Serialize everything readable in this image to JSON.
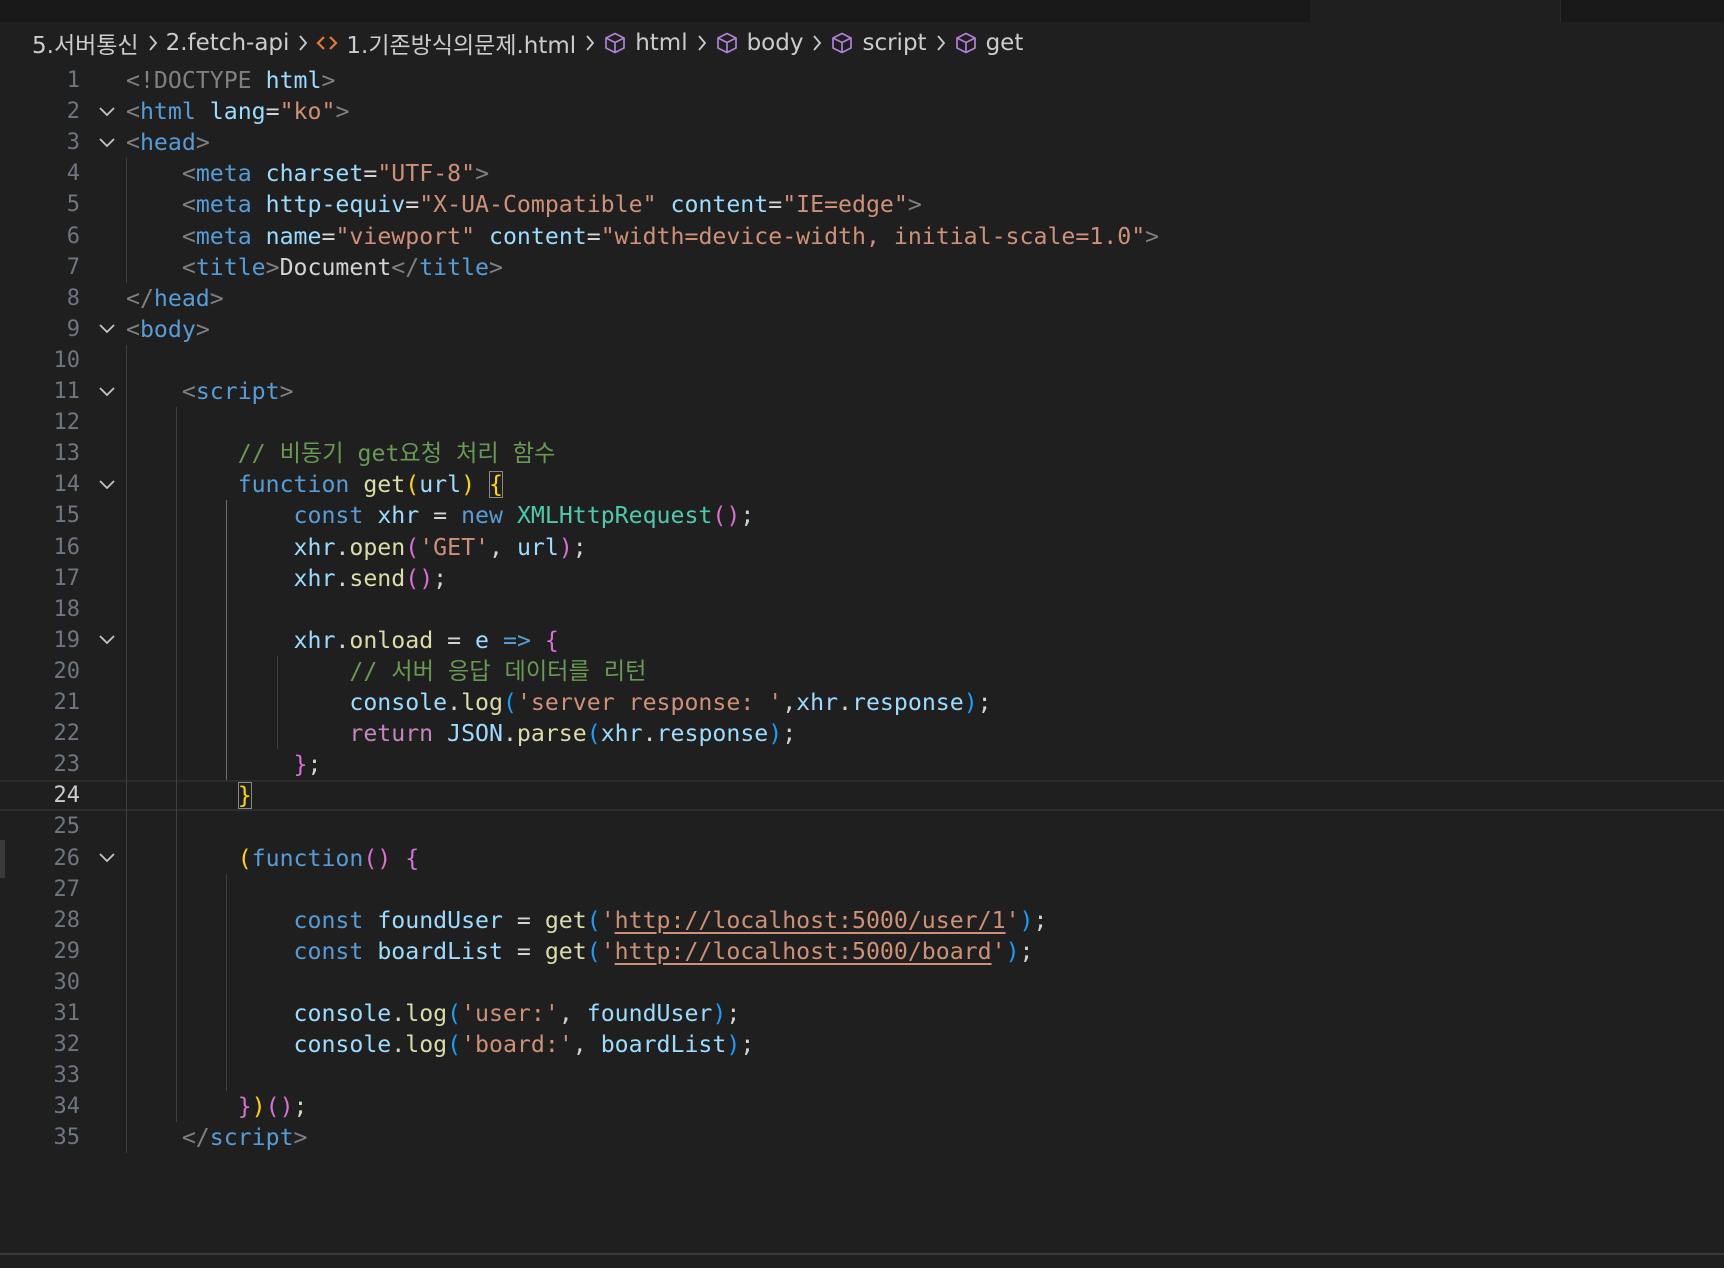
{
  "breadcrumb": {
    "items": [
      {
        "label": "5.서버통신",
        "icon": ""
      },
      {
        "label": "2.fetch-api",
        "icon": ""
      },
      {
        "label": "1.기존방식의문제.html",
        "icon": "html-file-icon"
      },
      {
        "label": "html",
        "icon": "cube-symbol-icon"
      },
      {
        "label": "body",
        "icon": "cube-symbol-icon"
      },
      {
        "label": "script",
        "icon": "cube-symbol-icon"
      },
      {
        "label": "get",
        "icon": "cube-symbol-icon"
      }
    ]
  },
  "editor": {
    "current_line": 24,
    "colors": {
      "tag_bracket": "#808080",
      "tag": "#569cd6",
      "attr": "#9cdcfe",
      "string": "#ce9178",
      "comment": "#6a9955",
      "keyword": "#569cd6",
      "control": "#c586c0",
      "function": "#dcdcaa",
      "variable": "#9cdcfe",
      "class": "#4ec9b0",
      "bracket1": "#ffd700",
      "bracket2": "#da70d6",
      "bracket3": "#179fff"
    },
    "lines": [
      {
        "n": 1,
        "fold": false,
        "tokens": [
          [
            "<!DOCTYPE ",
            "tb"
          ],
          [
            "html",
            "at"
          ],
          [
            ">",
            "tb"
          ]
        ]
      },
      {
        "n": 2,
        "fold": true,
        "tokens": [
          [
            "<",
            "tb"
          ],
          [
            "html",
            "tg"
          ],
          [
            " ",
            "pl"
          ],
          [
            "lang",
            "at"
          ],
          [
            "=",
            "pl"
          ],
          [
            "\"ko\"",
            "st"
          ],
          [
            ">",
            "tb"
          ]
        ]
      },
      {
        "n": 3,
        "fold": true,
        "tokens": [
          [
            "<",
            "tb"
          ],
          [
            "head",
            "tg"
          ],
          [
            ">",
            "tb"
          ]
        ]
      },
      {
        "n": 4,
        "fold": false,
        "tokens": [
          [
            "    ",
            "pl"
          ],
          [
            "<",
            "tb"
          ],
          [
            "meta",
            "tg"
          ],
          [
            " ",
            "pl"
          ],
          [
            "charset",
            "at"
          ],
          [
            "=",
            "pl"
          ],
          [
            "\"UTF-8\"",
            "st"
          ],
          [
            ">",
            "tb"
          ]
        ]
      },
      {
        "n": 5,
        "fold": false,
        "tokens": [
          [
            "    ",
            "pl"
          ],
          [
            "<",
            "tb"
          ],
          [
            "meta",
            "tg"
          ],
          [
            " ",
            "pl"
          ],
          [
            "http-equiv",
            "at"
          ],
          [
            "=",
            "pl"
          ],
          [
            "\"X-UA-Compatible\"",
            "st"
          ],
          [
            " ",
            "pl"
          ],
          [
            "content",
            "at"
          ],
          [
            "=",
            "pl"
          ],
          [
            "\"IE=edge\"",
            "st"
          ],
          [
            ">",
            "tb"
          ]
        ]
      },
      {
        "n": 6,
        "fold": false,
        "tokens": [
          [
            "    ",
            "pl"
          ],
          [
            "<",
            "tb"
          ],
          [
            "meta",
            "tg"
          ],
          [
            " ",
            "pl"
          ],
          [
            "name",
            "at"
          ],
          [
            "=",
            "pl"
          ],
          [
            "\"viewport\"",
            "st"
          ],
          [
            " ",
            "pl"
          ],
          [
            "content",
            "at"
          ],
          [
            "=",
            "pl"
          ],
          [
            "\"width=device-width, initial-scale=1.0\"",
            "st"
          ],
          [
            ">",
            "tb"
          ]
        ]
      },
      {
        "n": 7,
        "fold": false,
        "tokens": [
          [
            "    ",
            "pl"
          ],
          [
            "<",
            "tb"
          ],
          [
            "title",
            "tg"
          ],
          [
            ">",
            "tb"
          ],
          [
            "Document",
            "pl"
          ],
          [
            "</",
            "tb"
          ],
          [
            "title",
            "tg"
          ],
          [
            ">",
            "tb"
          ]
        ]
      },
      {
        "n": 8,
        "fold": false,
        "tokens": [
          [
            "</",
            "tb"
          ],
          [
            "head",
            "tg"
          ],
          [
            ">",
            "tb"
          ]
        ]
      },
      {
        "n": 9,
        "fold": true,
        "tokens": [
          [
            "<",
            "tb"
          ],
          [
            "body",
            "tg"
          ],
          [
            ">",
            "tb"
          ]
        ]
      },
      {
        "n": 10,
        "fold": false,
        "tokens": []
      },
      {
        "n": 11,
        "fold": true,
        "tokens": [
          [
            "    ",
            "pl"
          ],
          [
            "<",
            "tb"
          ],
          [
            "script",
            "tg"
          ],
          [
            ">",
            "tb"
          ]
        ]
      },
      {
        "n": 12,
        "fold": false,
        "tokens": []
      },
      {
        "n": 13,
        "fold": false,
        "tokens": [
          [
            "        ",
            "pl"
          ],
          [
            "// 비동기 get요청 처리 함수",
            "cm"
          ]
        ]
      },
      {
        "n": 14,
        "fold": true,
        "tokens": [
          [
            "        ",
            "pl"
          ],
          [
            "function",
            "kw"
          ],
          [
            " ",
            "pl"
          ],
          [
            "get",
            "fn"
          ],
          [
            "(",
            "b1"
          ],
          [
            "url",
            "vr"
          ],
          [
            ")",
            "b1"
          ],
          [
            " ",
            "pl"
          ],
          [
            "{",
            "b1box"
          ]
        ]
      },
      {
        "n": 15,
        "fold": false,
        "tokens": [
          [
            "            ",
            "pl"
          ],
          [
            "const",
            "kw"
          ],
          [
            " ",
            "pl"
          ],
          [
            "xhr",
            "vr"
          ],
          [
            " = ",
            "pl"
          ],
          [
            "new",
            "kw"
          ],
          [
            " ",
            "pl"
          ],
          [
            "XMLHttpRequest",
            "cl"
          ],
          [
            "()",
            "b2"
          ],
          [
            ";",
            "pl"
          ]
        ]
      },
      {
        "n": 16,
        "fold": false,
        "tokens": [
          [
            "            ",
            "pl"
          ],
          [
            "xhr",
            "vr"
          ],
          [
            ".",
            "pl"
          ],
          [
            "open",
            "fn"
          ],
          [
            "(",
            "b2"
          ],
          [
            "'GET'",
            "st"
          ],
          [
            ", ",
            "pl"
          ],
          [
            "url",
            "vr"
          ],
          [
            ")",
            "b2"
          ],
          [
            ";",
            "pl"
          ]
        ]
      },
      {
        "n": 17,
        "fold": false,
        "tokens": [
          [
            "            ",
            "pl"
          ],
          [
            "xhr",
            "vr"
          ],
          [
            ".",
            "pl"
          ],
          [
            "send",
            "fn"
          ],
          [
            "()",
            "b2"
          ],
          [
            ";",
            "pl"
          ]
        ]
      },
      {
        "n": 18,
        "fold": false,
        "tokens": []
      },
      {
        "n": 19,
        "fold": true,
        "tokens": [
          [
            "            ",
            "pl"
          ],
          [
            "xhr",
            "vr"
          ],
          [
            ".",
            "pl"
          ],
          [
            "onload",
            "fn"
          ],
          [
            " = ",
            "pl"
          ],
          [
            "e",
            "vr"
          ],
          [
            " ",
            "pl"
          ],
          [
            "=>",
            "kw"
          ],
          [
            " ",
            "pl"
          ],
          [
            "{",
            "b2"
          ]
        ]
      },
      {
        "n": 20,
        "fold": false,
        "tokens": [
          [
            "                ",
            "pl"
          ],
          [
            "// 서버 응답 데이터를 리턴",
            "cm"
          ]
        ]
      },
      {
        "n": 21,
        "fold": false,
        "tokens": [
          [
            "                ",
            "pl"
          ],
          [
            "console",
            "vr"
          ],
          [
            ".",
            "pl"
          ],
          [
            "log",
            "fn"
          ],
          [
            "(",
            "b3"
          ],
          [
            "'server response: '",
            "st"
          ],
          [
            ",",
            "pl"
          ],
          [
            "xhr",
            "vr"
          ],
          [
            ".",
            "pl"
          ],
          [
            "response",
            "vr"
          ],
          [
            ")",
            "b3"
          ],
          [
            ";",
            "pl"
          ]
        ]
      },
      {
        "n": 22,
        "fold": false,
        "tokens": [
          [
            "                ",
            "pl"
          ],
          [
            "return",
            "ct"
          ],
          [
            " ",
            "pl"
          ],
          [
            "JSON",
            "vr"
          ],
          [
            ".",
            "pl"
          ],
          [
            "parse",
            "fn"
          ],
          [
            "(",
            "b3"
          ],
          [
            "xhr",
            "vr"
          ],
          [
            ".",
            "pl"
          ],
          [
            "response",
            "vr"
          ],
          [
            ")",
            "b3"
          ],
          [
            ";",
            "pl"
          ]
        ]
      },
      {
        "n": 23,
        "fold": false,
        "tokens": [
          [
            "            ",
            "pl"
          ],
          [
            "}",
            "b2"
          ],
          [
            ";",
            "pl"
          ]
        ]
      },
      {
        "n": 24,
        "fold": false,
        "tokens": [
          [
            "        ",
            "pl"
          ],
          [
            "}",
            "b1box"
          ]
        ]
      },
      {
        "n": 25,
        "fold": false,
        "tokens": []
      },
      {
        "n": 26,
        "fold": true,
        "tokens": [
          [
            "        ",
            "pl"
          ],
          [
            "(",
            "b1"
          ],
          [
            "function",
            "kw"
          ],
          [
            "()",
            "b2"
          ],
          [
            " ",
            "pl"
          ],
          [
            "{",
            "b2"
          ]
        ]
      },
      {
        "n": 27,
        "fold": false,
        "tokens": []
      },
      {
        "n": 28,
        "fold": false,
        "tokens": [
          [
            "            ",
            "pl"
          ],
          [
            "const",
            "kw"
          ],
          [
            " ",
            "pl"
          ],
          [
            "foundUser",
            "vr"
          ],
          [
            " = ",
            "pl"
          ],
          [
            "get",
            "fn"
          ],
          [
            "(",
            "b3"
          ],
          [
            "'",
            "st"
          ],
          [
            "http://localhost:5000/user/1",
            "stu"
          ],
          [
            "'",
            "st"
          ],
          [
            ")",
            "b3"
          ],
          [
            ";",
            "pl"
          ]
        ]
      },
      {
        "n": 29,
        "fold": false,
        "tokens": [
          [
            "            ",
            "pl"
          ],
          [
            "const",
            "kw"
          ],
          [
            " ",
            "pl"
          ],
          [
            "boardList",
            "vr"
          ],
          [
            " = ",
            "pl"
          ],
          [
            "get",
            "fn"
          ],
          [
            "(",
            "b3"
          ],
          [
            "'",
            "st"
          ],
          [
            "http://localhost:5000/board",
            "stu"
          ],
          [
            "'",
            "st"
          ],
          [
            ")",
            "b3"
          ],
          [
            ";",
            "pl"
          ]
        ]
      },
      {
        "n": 30,
        "fold": false,
        "tokens": []
      },
      {
        "n": 31,
        "fold": false,
        "tokens": [
          [
            "            ",
            "pl"
          ],
          [
            "console",
            "vr"
          ],
          [
            ".",
            "pl"
          ],
          [
            "log",
            "fn"
          ],
          [
            "(",
            "b3"
          ],
          [
            "'user:'",
            "st"
          ],
          [
            ", ",
            "pl"
          ],
          [
            "foundUser",
            "vr"
          ],
          [
            ")",
            "b3"
          ],
          [
            ";",
            "pl"
          ]
        ]
      },
      {
        "n": 32,
        "fold": false,
        "tokens": [
          [
            "            ",
            "pl"
          ],
          [
            "console",
            "vr"
          ],
          [
            ".",
            "pl"
          ],
          [
            "log",
            "fn"
          ],
          [
            "(",
            "b3"
          ],
          [
            "'board:'",
            "st"
          ],
          [
            ", ",
            "pl"
          ],
          [
            "boardList",
            "vr"
          ],
          [
            ")",
            "b3"
          ],
          [
            ";",
            "pl"
          ]
        ]
      },
      {
        "n": 33,
        "fold": false,
        "tokens": []
      },
      {
        "n": 34,
        "fold": false,
        "tokens": [
          [
            "        ",
            "pl"
          ],
          [
            "}",
            "b2"
          ],
          [
            ")",
            "b1"
          ],
          [
            "()",
            "b2"
          ],
          [
            ";",
            "pl"
          ]
        ]
      },
      {
        "n": 35,
        "fold": false,
        "tokens": [
          [
            "    ",
            "pl"
          ],
          [
            "</",
            "tb"
          ],
          [
            "script",
            "tg"
          ],
          [
            ">",
            "tb"
          ]
        ]
      }
    ]
  }
}
